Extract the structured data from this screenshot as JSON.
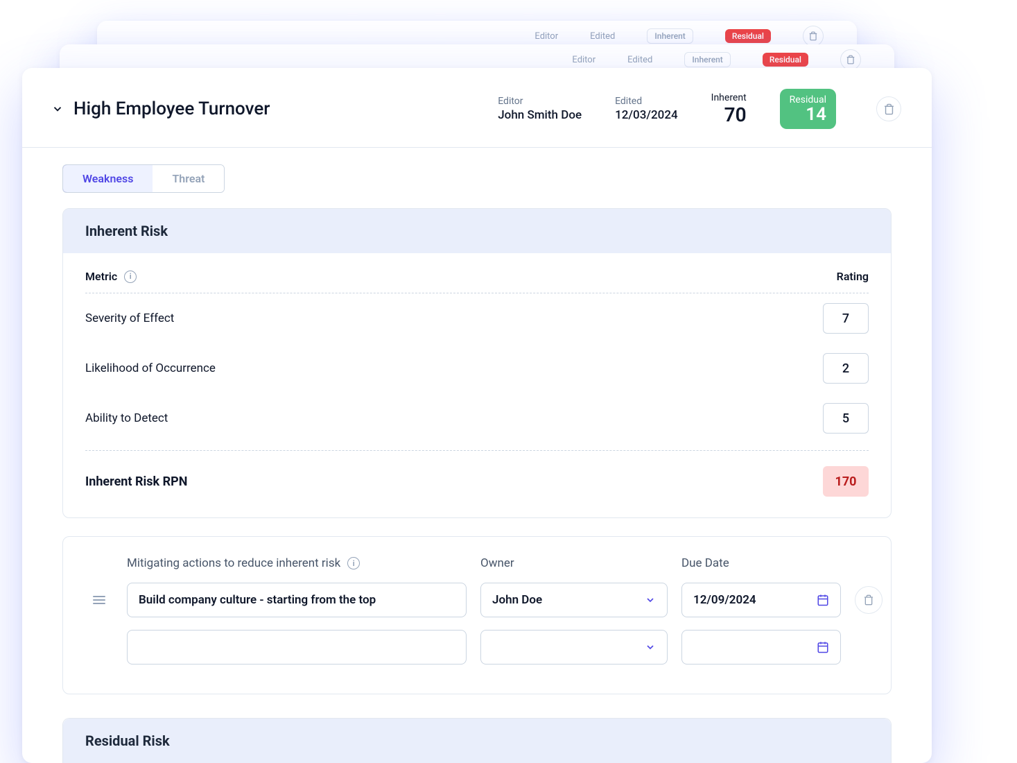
{
  "backgroundCards": [
    {
      "editorLabel": "Editor",
      "editedLabel": "Edited",
      "inherentPill": "Inherent",
      "residualPill": "Residual"
    },
    {
      "editorLabel": "Editor",
      "editedLabel": "Edited",
      "inherentPill": "Inherent",
      "residualPill": "Residual"
    }
  ],
  "header": {
    "title": "High Employee Turnover",
    "editorLabel": "Editor",
    "editorValue": "John Smith Doe",
    "editedLabel": "Edited",
    "editedValue": "12/03/2024",
    "inherentLabel": "Inherent",
    "inherentValue": "70",
    "residualLabel": "Residual",
    "residualValue": "14"
  },
  "tabs": {
    "weakness": "Weakness",
    "threat": "Threat"
  },
  "inherentRisk": {
    "panelTitle": "Inherent Risk",
    "metricLabel": "Metric",
    "ratingLabel": "Rating",
    "rows": [
      {
        "name": "Severity of Effect",
        "value": "7"
      },
      {
        "name": "Likelihood of Occurrence",
        "value": "2"
      },
      {
        "name": "Ability to Detect",
        "value": "5"
      }
    ],
    "rpnLabel": "Inherent Risk RPN",
    "rpnValue": "170"
  },
  "actions": {
    "actionsLabel": "Mitigating actions to reduce inherent risk",
    "ownerLabel": "Owner",
    "dueDateLabel": "Due Date",
    "rows": [
      {
        "action": "Build company culture - starting from the top",
        "owner": "John Doe",
        "dueDate": "12/09/2024"
      },
      {
        "action": "",
        "owner": "",
        "dueDate": ""
      }
    ]
  },
  "residualRisk": {
    "panelTitle": "Residual Risk"
  }
}
